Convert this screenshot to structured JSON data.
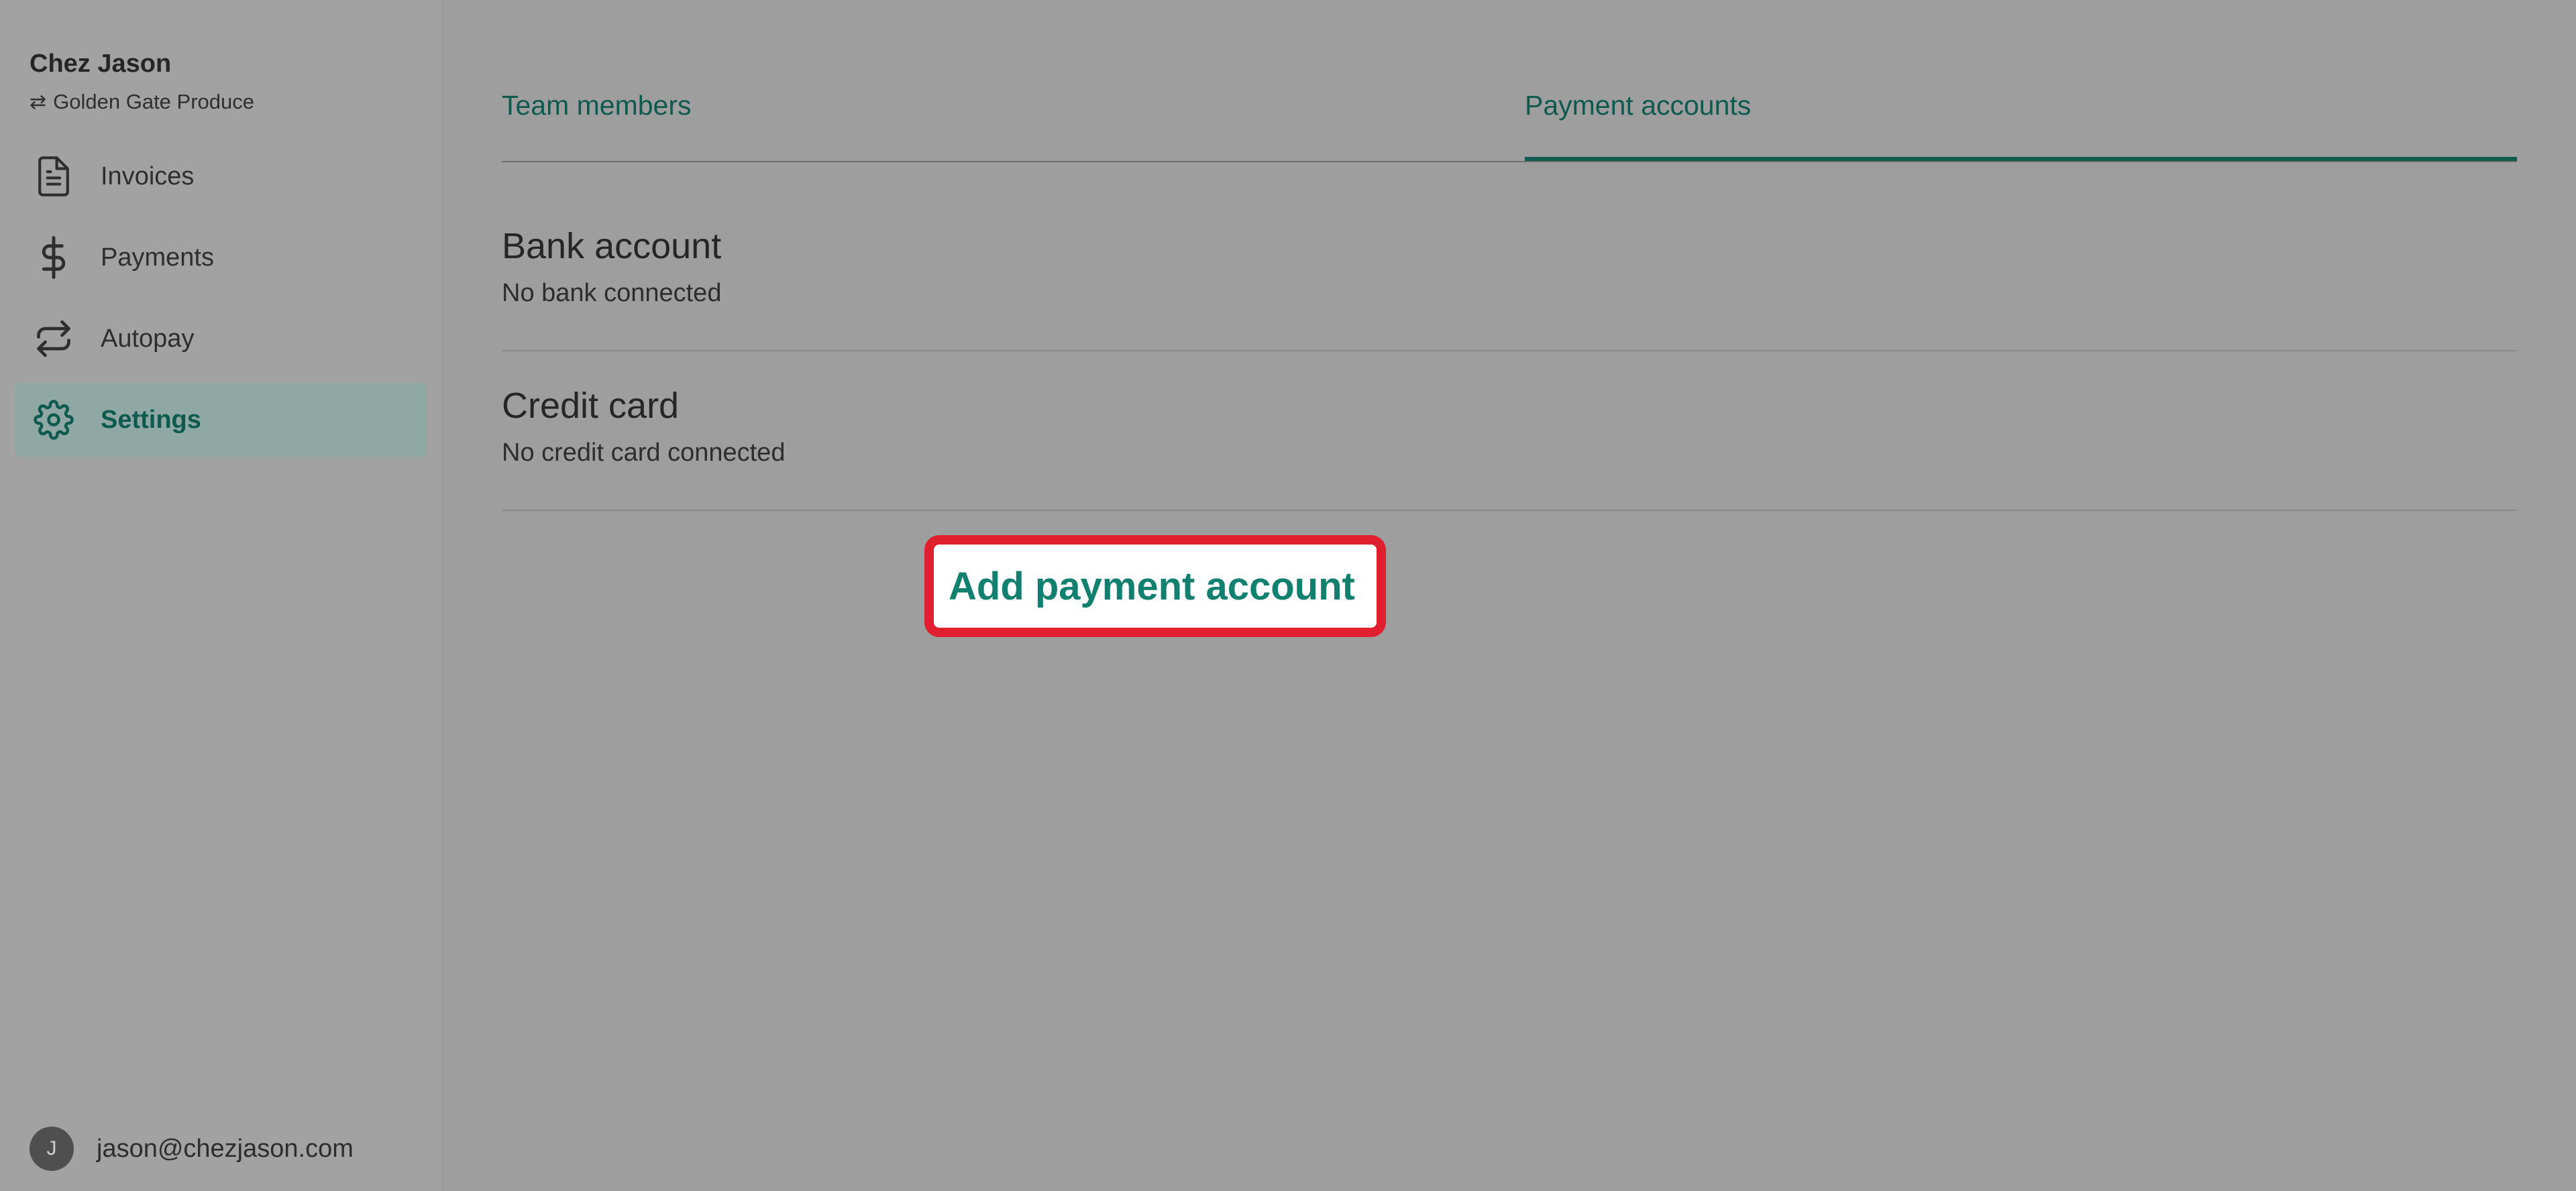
{
  "sidebar": {
    "org_name": "Chez Jason",
    "org_switch_label": "Golden Gate Produce",
    "org_switch_icon": "swap-arrows-icon",
    "items": [
      {
        "label": "Invoices",
        "icon": "document-icon",
        "active": false
      },
      {
        "label": "Payments",
        "icon": "dollar-icon",
        "active": false
      },
      {
        "label": "Autopay",
        "icon": "repeat-icon",
        "active": false
      },
      {
        "label": "Settings",
        "icon": "gear-icon",
        "active": true
      }
    ],
    "user": {
      "avatar_initial": "J",
      "email": "jason@chezjason.com"
    }
  },
  "tabs": {
    "items": [
      {
        "label": "Team members",
        "active": false
      },
      {
        "label": "Payment accounts",
        "active": true
      }
    ]
  },
  "sections": {
    "bank": {
      "title": "Bank account",
      "status": "No bank connected"
    },
    "card": {
      "title": "Credit card",
      "status": "No credit card connected"
    }
  },
  "actions": {
    "add_payment_account": "Add payment account"
  },
  "colors": {
    "accent": "#0f5a4e",
    "button_text": "#12806f",
    "highlight_border": "#e0202e",
    "overlay_background": "#9e9e9e"
  }
}
